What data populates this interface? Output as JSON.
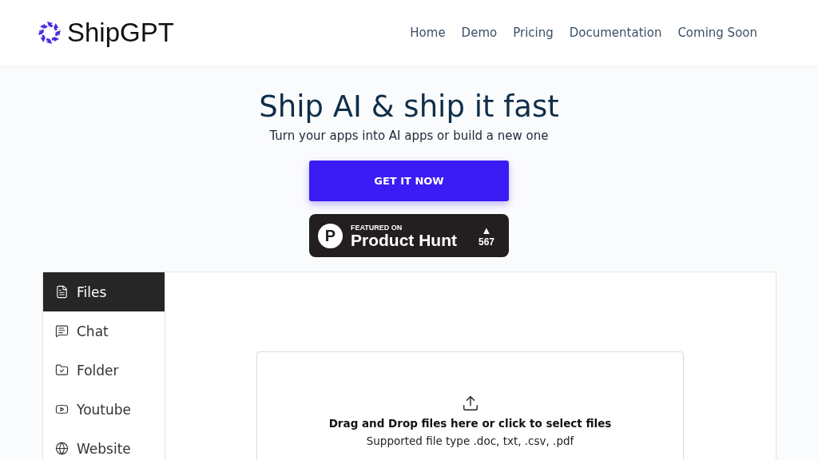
{
  "brand": {
    "name": "ShipGPT"
  },
  "nav": [
    "Home",
    "Demo",
    "Pricing",
    "Documentation",
    "Coming Soon"
  ],
  "hero": {
    "title": "Ship AI & ship it fast",
    "subtitle": "Turn your apps into AI apps or build a new one",
    "cta": "GET IT NOW"
  },
  "badge": {
    "eyebrow": "FEATURED ON",
    "name": "Product Hunt",
    "letter": "P",
    "arrow": "▲",
    "count": "567"
  },
  "sidebar": {
    "items": [
      {
        "label": "Files",
        "kind": "file",
        "selected": true
      },
      {
        "label": "Chat",
        "kind": "chat",
        "selected": false
      },
      {
        "label": "Folder",
        "kind": "folder",
        "selected": false
      },
      {
        "label": "Youtube",
        "kind": "video",
        "selected": false
      },
      {
        "label": "Website",
        "kind": "globe",
        "selected": false
      }
    ]
  },
  "upload": {
    "title": "Drag and Drop files here or click to select files",
    "hint": "Supported file type .doc, txt, .csv, .pdf"
  }
}
